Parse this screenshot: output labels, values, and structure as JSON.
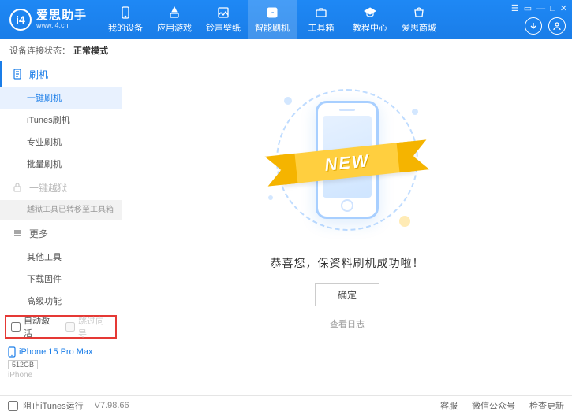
{
  "app": {
    "title": "爱思助手",
    "subtitle": "www.i4.cn"
  },
  "nav": {
    "items": [
      {
        "label": "我的设备"
      },
      {
        "label": "应用游戏"
      },
      {
        "label": "铃声壁纸"
      },
      {
        "label": "智能刷机"
      },
      {
        "label": "工具箱"
      },
      {
        "label": "教程中心"
      },
      {
        "label": "爱思商城"
      }
    ],
    "active_index": 3
  },
  "status": {
    "label": "设备连接状态：",
    "value": "正常模式"
  },
  "sidebar": {
    "flash_header": "刷机",
    "flash_items": [
      "一键刷机",
      "iTunes刷机",
      "专业刷机",
      "批量刷机"
    ],
    "flash_active": 0,
    "jailbreak_header": "一键越狱",
    "jailbreak_note": "越狱工具已转移至工具箱",
    "more_header": "更多",
    "more_items": [
      "其他工具",
      "下载固件",
      "高级功能"
    ],
    "checkbox_auto_activate": "自动激活",
    "checkbox_skip_guide": "跳过向导"
  },
  "device": {
    "name": "iPhone 15 Pro Max",
    "storage": "512GB",
    "type": "iPhone"
  },
  "main": {
    "ribbon": "NEW",
    "success_message": "恭喜您，保资料刷机成功啦！",
    "ok_button": "确定",
    "view_log": "查看日志"
  },
  "footer": {
    "block_itunes": "阻止iTunes运行",
    "version": "V7.98.66",
    "links": [
      "客服",
      "微信公众号",
      "检查更新"
    ]
  }
}
